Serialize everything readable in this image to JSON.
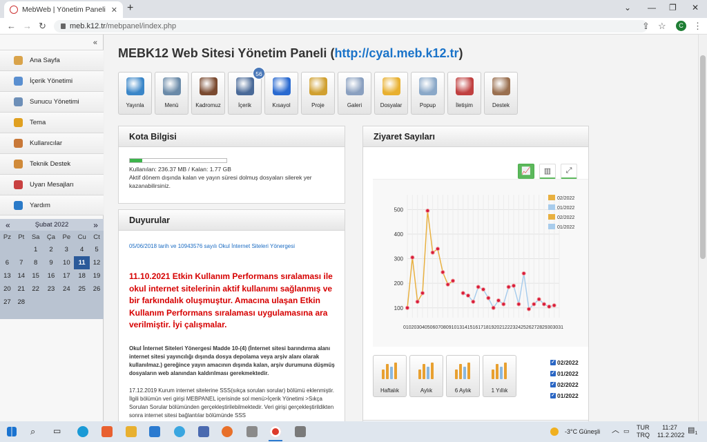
{
  "browser": {
    "tab_title": "MebWeb | Yönetim Paneli",
    "url_host": "meb.k12.tr",
    "url_path": "/mebpanel/index.php",
    "profile_initial": "C"
  },
  "sidebar": {
    "items": [
      {
        "label": "Ana Sayfa",
        "icon": "home-icon",
        "color": "#d9a34a"
      },
      {
        "label": "İçerik Yönetimi",
        "icon": "content-icon",
        "color": "#5a8fd0"
      },
      {
        "label": "Sunucu Yönetimi",
        "icon": "server-icon",
        "color": "#6d8fb8"
      },
      {
        "label": "Tema",
        "icon": "theme-icon",
        "color": "#e0a020"
      },
      {
        "label": "Kullanıcılar",
        "icon": "users-icon",
        "color": "#c87838"
      },
      {
        "label": "Teknik Destek",
        "icon": "support-icon",
        "color": "#d08a3a"
      },
      {
        "label": "Uyarı Mesajları",
        "icon": "warning-icon",
        "color": "#c84040"
      },
      {
        "label": "Yardım",
        "icon": "help-icon",
        "color": "#2a7ac8"
      }
    ]
  },
  "calendar": {
    "month": "Şubat 2022",
    "weekdays": [
      "Pz",
      "Pt",
      "Sa",
      "Ça",
      "Pe",
      "Cu",
      "Ct"
    ],
    "weeks": [
      [
        "",
        "",
        "1",
        "2",
        "3",
        "4",
        "5"
      ],
      [
        "6",
        "7",
        "8",
        "9",
        "10",
        "11",
        "12"
      ],
      [
        "13",
        "14",
        "15",
        "16",
        "17",
        "18",
        "19"
      ],
      [
        "20",
        "21",
        "22",
        "23",
        "24",
        "25",
        "26"
      ],
      [
        "27",
        "28",
        "",
        "",
        "",
        "",
        ""
      ]
    ],
    "today": "11"
  },
  "header": {
    "title": "MEBK12 Web Sitesi Yönetim Paneli",
    "link": "http://cyal.meb.k12.tr"
  },
  "toolbar": {
    "buttons": [
      {
        "label": "Yayınla",
        "color": "#3a86c8"
      },
      {
        "label": "Menü",
        "color": "#6a8aa8"
      },
      {
        "label": "Kadromuz",
        "color": "#7a4a30"
      },
      {
        "label": "İçerik",
        "color": "#4a6a98",
        "badge": "56"
      },
      {
        "label": "Kısayol",
        "color": "#2a6ad0"
      },
      {
        "label": "Proje",
        "color": "#d0a030"
      },
      {
        "label": "Galeri",
        "color": "#8aa0c0"
      },
      {
        "label": "Dosyalar",
        "color": "#e8b030"
      },
      {
        "label": "Popup",
        "color": "#8aa8c8"
      },
      {
        "label": "İletişim",
        "color": "#c04040"
      },
      {
        "label": "Destek",
        "color": "#9a7050"
      }
    ]
  },
  "quota": {
    "title": "Kota Bilgisi",
    "used_fraction": 0.13,
    "usage": "Kullanılan: 236.37 MB / Kalan: 1.77 GB",
    "note": "Aktif dönem dışında kalan ve yayın süresi dolmuş dosyaları silerek yer kazanabilirsiniz."
  },
  "announcements": {
    "title": "Duyurular",
    "link": "05/06/2018 tarih ve 10943576 sayılı Okul İnternet Siteleri Yönergesi",
    "highlight": "11.10.2021 Etkin Kullanım Performans sıralaması ile okul internet sitelerinin aktif kullanımı sağlanmış ve bir farkındalık oluşmuştur. Amacına ulaşan Etkin Kullanım Performans sıralaması uygulamasına ara verilmiştir. İyi çalışmalar.",
    "bold_text": "Okul İnternet Siteleri Yönergesi Madde 10-(4) (İnternet sitesi barındırma alanı internet sitesi yayıncılığı dışında dosya depolama veya arşiv alanı olarak kullanılmaz.) gereğince yayın amacının dışında kalan, arşiv durumuna düşmüş dosyaların web alanından kaldırılması gerekmektedir.",
    "text": "17.12.2019 Kurum internet sitelerine SSS(sıkça sorulan sorular) bölümü eklenmiştir. İlgili bölümün veri girişi MEBPANEL içerisinde sol menü>İçerik Yönetimi >Sıkça Sorulan Sorular bölümünden gerçekleştirilebilmektedir. Veri girişi gerçekleştirildikten sonra internet sitesi bağlantılar bölümünde SSS"
  },
  "visits": {
    "title": "Ziyaret Sayıları",
    "view_buttons": [
      {
        "icon": "line-chart-icon",
        "glyph": "📈",
        "active": true
      },
      {
        "icon": "bar-chart-icon",
        "glyph": "▥",
        "active": false
      },
      {
        "icon": "fullscreen-icon",
        "glyph": "⤢",
        "active": false
      }
    ],
    "periods": [
      "Haftalık",
      "Aylık",
      "6 Aylık",
      "1 Yıllık"
    ],
    "checkboxes": [
      "02/2022",
      "01/2022",
      "02/2022",
      "01/2022"
    ]
  },
  "chart_data": {
    "type": "line",
    "x": [
      "01",
      "02",
      "03",
      "04",
      "05",
      "06",
      "07",
      "08",
      "09",
      "10",
      "11",
      "12",
      "13",
      "14",
      "15",
      "16",
      "17",
      "18",
      "19",
      "20",
      "21",
      "22",
      "23",
      "24",
      "25",
      "26",
      "27",
      "28",
      "29",
      "30",
      "31"
    ],
    "x_tick_text": "010203040506070809101314151617181920212223242526272829303031",
    "yticks": [
      100,
      200,
      300,
      400,
      500
    ],
    "ylim": [
      60,
      560
    ],
    "legend": [
      "02/2022",
      "01/2022",
      "02/2022",
      "01/2022"
    ],
    "legend_colors": [
      "#e8b040",
      "#a8ccec",
      "#e8b040",
      "#a8ccec"
    ],
    "legend_position": "top-right",
    "grid": true,
    "series": [
      {
        "name": "02/2022",
        "color": "#e8b040",
        "values": [
          100,
          305,
          125,
          160,
          495,
          325,
          340,
          245,
          195,
          210
        ]
      },
      {
        "name": "01/2022",
        "color": "#a8ccec",
        "values": [
          160,
          150,
          125,
          185,
          175,
          140,
          100,
          130,
          115,
          185,
          190,
          115,
          240,
          95,
          115,
          135,
          115,
          105,
          110
        ],
        "start_index": 11
      }
    ]
  },
  "taskbar": {
    "weather": "-3°C  Güneşli",
    "lang_top": "TUR",
    "lang_bottom": "TRQ",
    "time": "11:27",
    "date": "11.2.2022",
    "notifications": "1"
  }
}
